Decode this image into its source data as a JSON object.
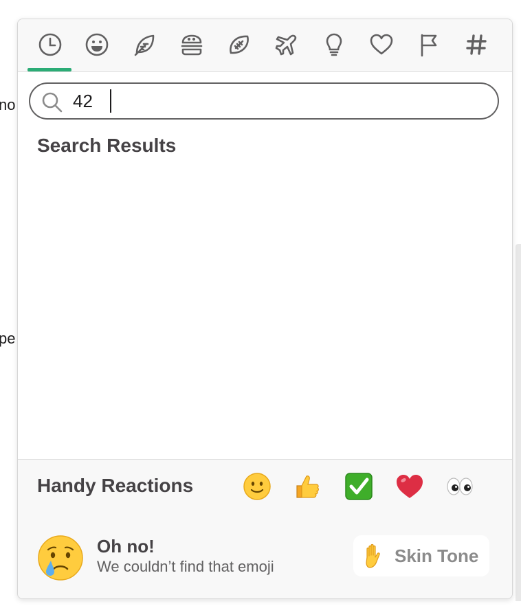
{
  "background": {
    "fragment_top": "no",
    "fragment_bottom": "pe"
  },
  "category_tabs": [
    {
      "icon": "clock-icon",
      "name": "recent",
      "active": true
    },
    {
      "icon": "smiley-icon",
      "name": "smileys-people"
    },
    {
      "icon": "leaf-icon",
      "name": "nature"
    },
    {
      "icon": "burger-icon",
      "name": "food-drink"
    },
    {
      "icon": "football-icon",
      "name": "activity"
    },
    {
      "icon": "airplane-icon",
      "name": "travel-places"
    },
    {
      "icon": "lightbulb-icon",
      "name": "objects"
    },
    {
      "icon": "heart-icon",
      "name": "symbols"
    },
    {
      "icon": "flag-icon",
      "name": "flags"
    },
    {
      "icon": "hash-icon",
      "name": "custom"
    }
  ],
  "accent_color": "#2bac76",
  "search": {
    "value": "42",
    "placeholder": ""
  },
  "results": {
    "title": "Search Results"
  },
  "handy_reactions": {
    "title": "Handy Reactions",
    "emojis": [
      "slightly-smiling-face",
      "thumbs-up",
      "white-check-mark",
      "heart",
      "eyes"
    ]
  },
  "footer": {
    "title": "Oh no!",
    "subtitle": "We couldn’t find that emoji",
    "face_icon": "cry-face"
  },
  "skin_tone": {
    "label": "Skin Tone",
    "icon": "raised-hand"
  }
}
